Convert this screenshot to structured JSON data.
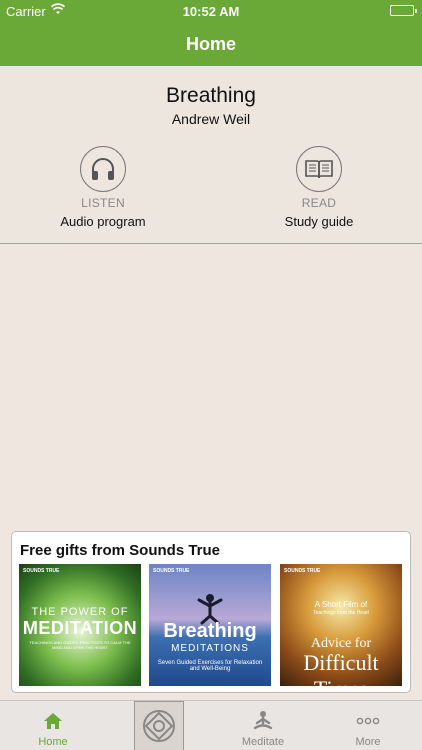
{
  "status_bar": {
    "carrier": "Carrier",
    "time": "10:52 AM"
  },
  "nav": {
    "title": "Home"
  },
  "program": {
    "title": "Breathing",
    "author": "Andrew Weil",
    "actions": [
      {
        "caption": "LISTEN",
        "label": "Audio program",
        "icon": "headphones-icon"
      },
      {
        "caption": "READ",
        "label": "Study guide",
        "icon": "book-icon"
      }
    ]
  },
  "gifts": {
    "title": "Free gifts from Sounds True",
    "items": [
      {
        "logo": "SOUNDS TRUE",
        "line1": "THE POWER OF",
        "line2": "MEDITATION",
        "line3": "TEACHINGS AND GUIDED PRACTICES TO CALM THE MIND AND OPEN THE HEART",
        "theme_color": "#5fa03a"
      },
      {
        "logo": "SOUNDS TRUE",
        "line1": "Breathing",
        "line2": "MEDITATIONS",
        "line3": "Seven Guided Exercises for Relaxation and Well-Being",
        "theme_color": "#3d6fb1"
      },
      {
        "logo": "SOUNDS TRUE",
        "line1": "A Short Film of",
        "line2": "Teachings from the Heart",
        "line3": "Advice for",
        "line4": "Difficult Times",
        "theme_color": "#b0702a"
      }
    ]
  },
  "tab_bar": {
    "tabs": [
      {
        "label": "Home",
        "icon": "home-icon",
        "active": true
      },
      {
        "label": "",
        "icon": "lotus-logo-icon",
        "active": false
      },
      {
        "label": "Meditate",
        "icon": "meditate-icon",
        "active": false
      },
      {
        "label": "More",
        "icon": "more-icon",
        "active": false
      }
    ],
    "active_color": "#6aa837"
  }
}
